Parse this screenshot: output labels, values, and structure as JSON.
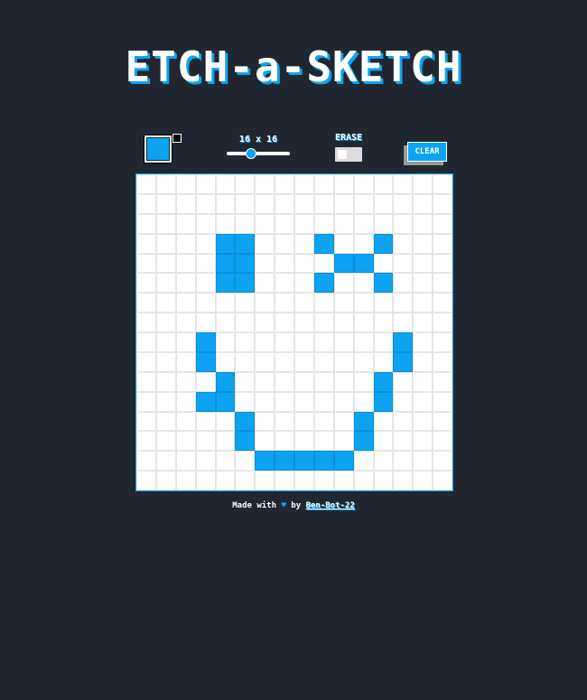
{
  "header": {
    "title": "ETCH-a-SKETCH"
  },
  "controls": {
    "primary_color": "#0da3f3",
    "secondary_color": "#000000",
    "size_label": "16 x 16",
    "grid_size": 16,
    "erase_label": "ERASE",
    "erase_on": false,
    "clear_label": "CLEAR"
  },
  "grid": {
    "rows": 16,
    "cols": 16,
    "fill_color": "#0da3f3",
    "filled_cells": [
      [
        3,
        4
      ],
      [
        3,
        5
      ],
      [
        3,
        9
      ],
      [
        3,
        12
      ],
      [
        4,
        4
      ],
      [
        4,
        5
      ],
      [
        4,
        10
      ],
      [
        4,
        11
      ],
      [
        5,
        4
      ],
      [
        5,
        5
      ],
      [
        5,
        9
      ],
      [
        5,
        12
      ],
      [
        8,
        3
      ],
      [
        8,
        13
      ],
      [
        9,
        3
      ],
      [
        9,
        13
      ],
      [
        10,
        4
      ],
      [
        10,
        12
      ],
      [
        11,
        3
      ],
      [
        11,
        4
      ],
      [
        11,
        12
      ],
      [
        12,
        5
      ],
      [
        12,
        11
      ],
      [
        13,
        5
      ],
      [
        13,
        11
      ],
      [
        14,
        6
      ],
      [
        14,
        7
      ],
      [
        14,
        8
      ],
      [
        14,
        9
      ],
      [
        14,
        10
      ]
    ]
  },
  "footer": {
    "made_with": "Made with",
    "heart": "♥",
    "by": "by",
    "author": "Ben-Bot-22"
  }
}
